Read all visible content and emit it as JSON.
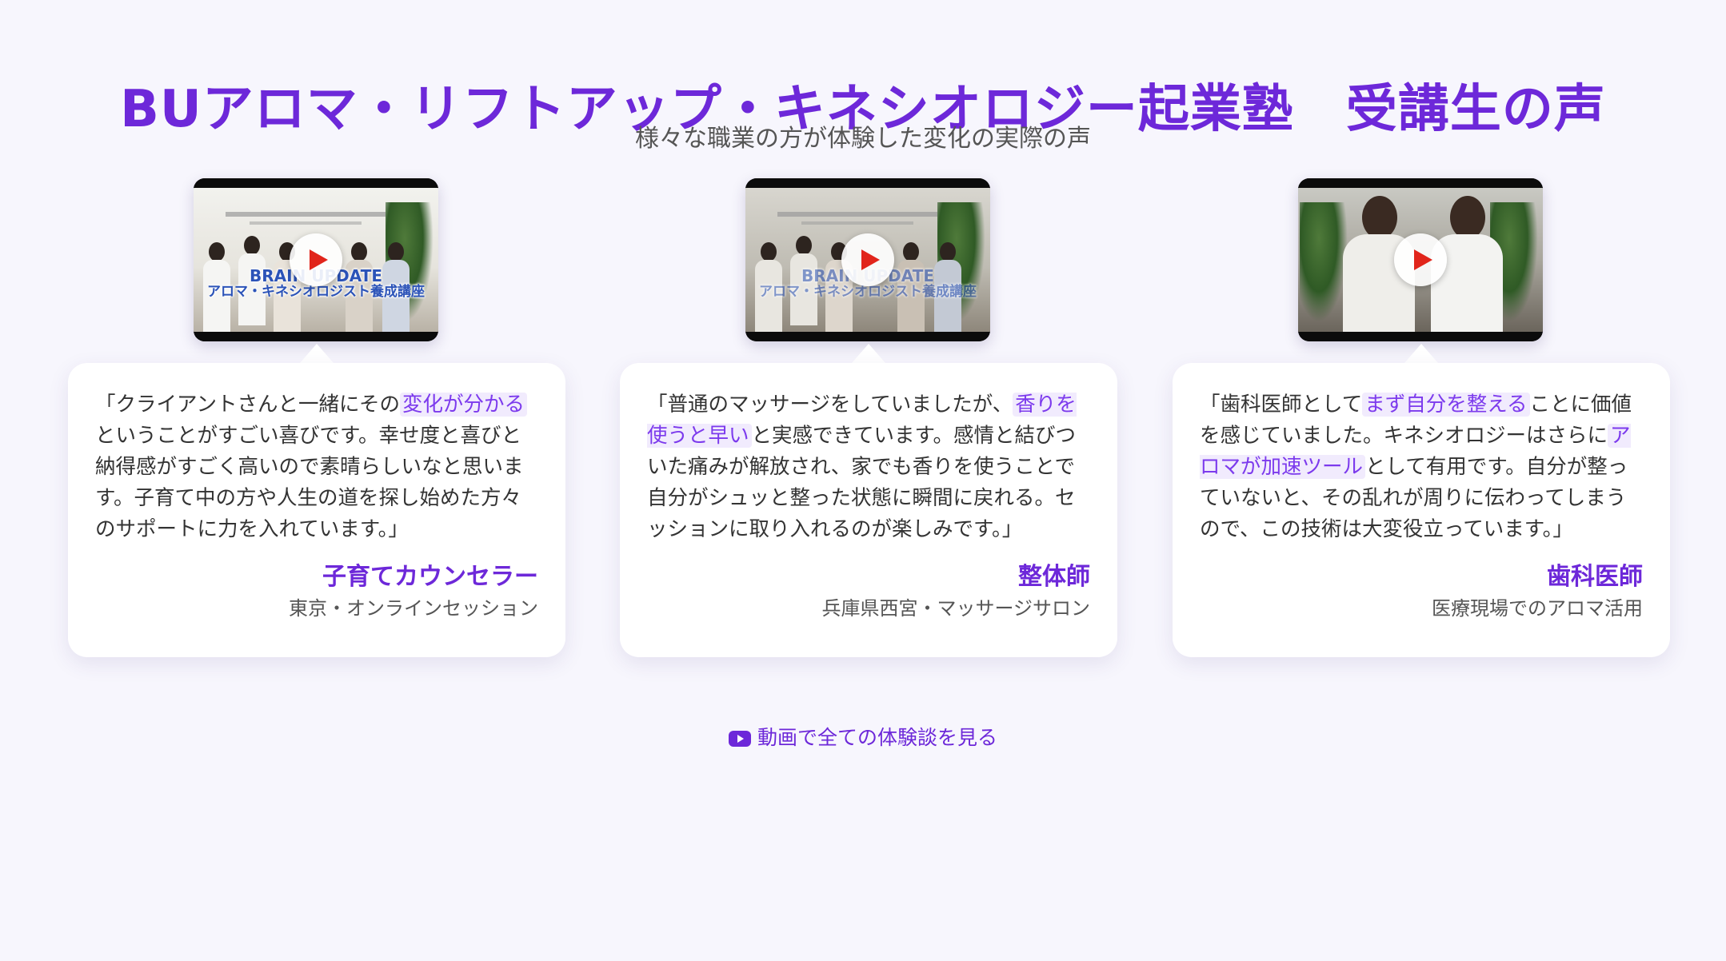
{
  "header": {
    "title": "BUアロマ・リフトアップ・キネシオロジー起業塾　受講生の声",
    "subtitle": "様々な職業の方が体験した変化の実際の声"
  },
  "testimonials": [
    {
      "video": {
        "caption_line1": "BRAIN UPDATE",
        "caption_line2": "アロマ・キネシオロジスト養成講座"
      },
      "quote_before": "「クライアントさんと一緒にその",
      "highlight1": "変化が分かる",
      "quote_middle": "ということがすごい喜びです。幸せ度と喜びと納得感がすごく高いので素晴らしいなと思います。子育て中の方や人生の道を探し始めた方々のサポートに力を入れています。」",
      "highlight2": "",
      "quote_after": "",
      "profession": "子育てカウンセラー",
      "location": "東京・オンラインセッション"
    },
    {
      "video": {
        "caption_line1": "BRAIN UPDATE",
        "caption_line2": "アロマ・キネシオロジスト養成講座"
      },
      "quote_before": "「普通のマッサージをしていましたが、",
      "highlight1": "香りを使うと早い",
      "quote_middle": "と実感できています。感情と結びついた痛みが解放され、家でも香りを使うことで自分がシュッと整った状態に瞬間に戻れる。セッションに取り入れるのが楽しみです。」",
      "highlight2": "",
      "quote_after": "",
      "profession": "整体師",
      "location": "兵庫県西宮・マッサージサロン"
    },
    {
      "video": {
        "caption_line1": "",
        "caption_line2": ""
      },
      "quote_before": "「歯科医師として",
      "highlight1": "まず自分を整える",
      "quote_middle": "ことに価値を感じていました。キネシオロジーはさらに",
      "highlight2": "アロマが加速ツール",
      "quote_after": "として有用です。自分が整っていないと、その乱れが周りに伝わってしまうので、この技術は大変役立っています。」",
      "profession": "歯科医師",
      "location": "医療現場でのアロマ活用"
    }
  ],
  "footer": {
    "more_link": "動画で全ての体験談を見る",
    "link_icon": "youtube-icon"
  },
  "colors": {
    "accent": "#6d28d9",
    "highlight_bg": "#f1ebfd",
    "background": "#f7f6fd",
    "play_red": "#e1251b"
  }
}
